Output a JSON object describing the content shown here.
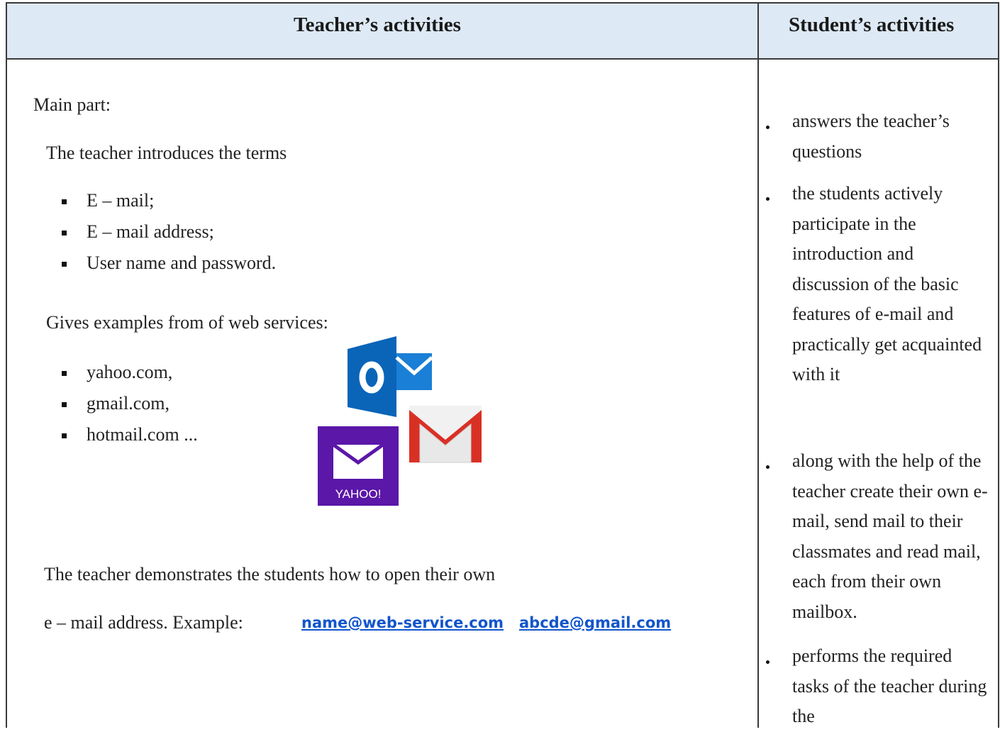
{
  "header": {
    "teacher_title": "Teacher’s activities",
    "student_title": "Student’s activities"
  },
  "teacher": {
    "main_part": "Main part:",
    "intro": "The teacher introduces the terms",
    "terms": [
      "E – mail;",
      "E – mail address;",
      "User name and password."
    ],
    "examples_heading": "Gives examples from of web services:",
    "services": [
      "yahoo.com,",
      "gmail.com,",
      "hotmail.com ..."
    ],
    "logos": {
      "outlook": "outlook-logo",
      "gmail": "gmail-logo",
      "yahoo": "yahoo-mail-logo",
      "yahoo_text": "YAHOO!"
    },
    "demo_line1": "The teacher demonstrates the students how to open their own",
    "demo_line2": "e – mail address. Example:",
    "link1": "name@web-service.com",
    "link2": "abcde@gmail.com"
  },
  "student": {
    "items": [
      "answers the teacher’s questions",
      "the students actively participate in the introduction and discussion of the basic features of e-mail and practically get acquainted with it",
      "along with the help of the teacher create their own e-mail, send mail to their classmates and read mail, each from their own mailbox.",
      "performs the required tasks of the teacher during the"
    ]
  },
  "colors": {
    "header_bg": "#dde9f4",
    "link": "#1155cc",
    "outlook": "#0a64b8",
    "yahoo": "#5b17a8",
    "gmail_red": "#d93025"
  }
}
